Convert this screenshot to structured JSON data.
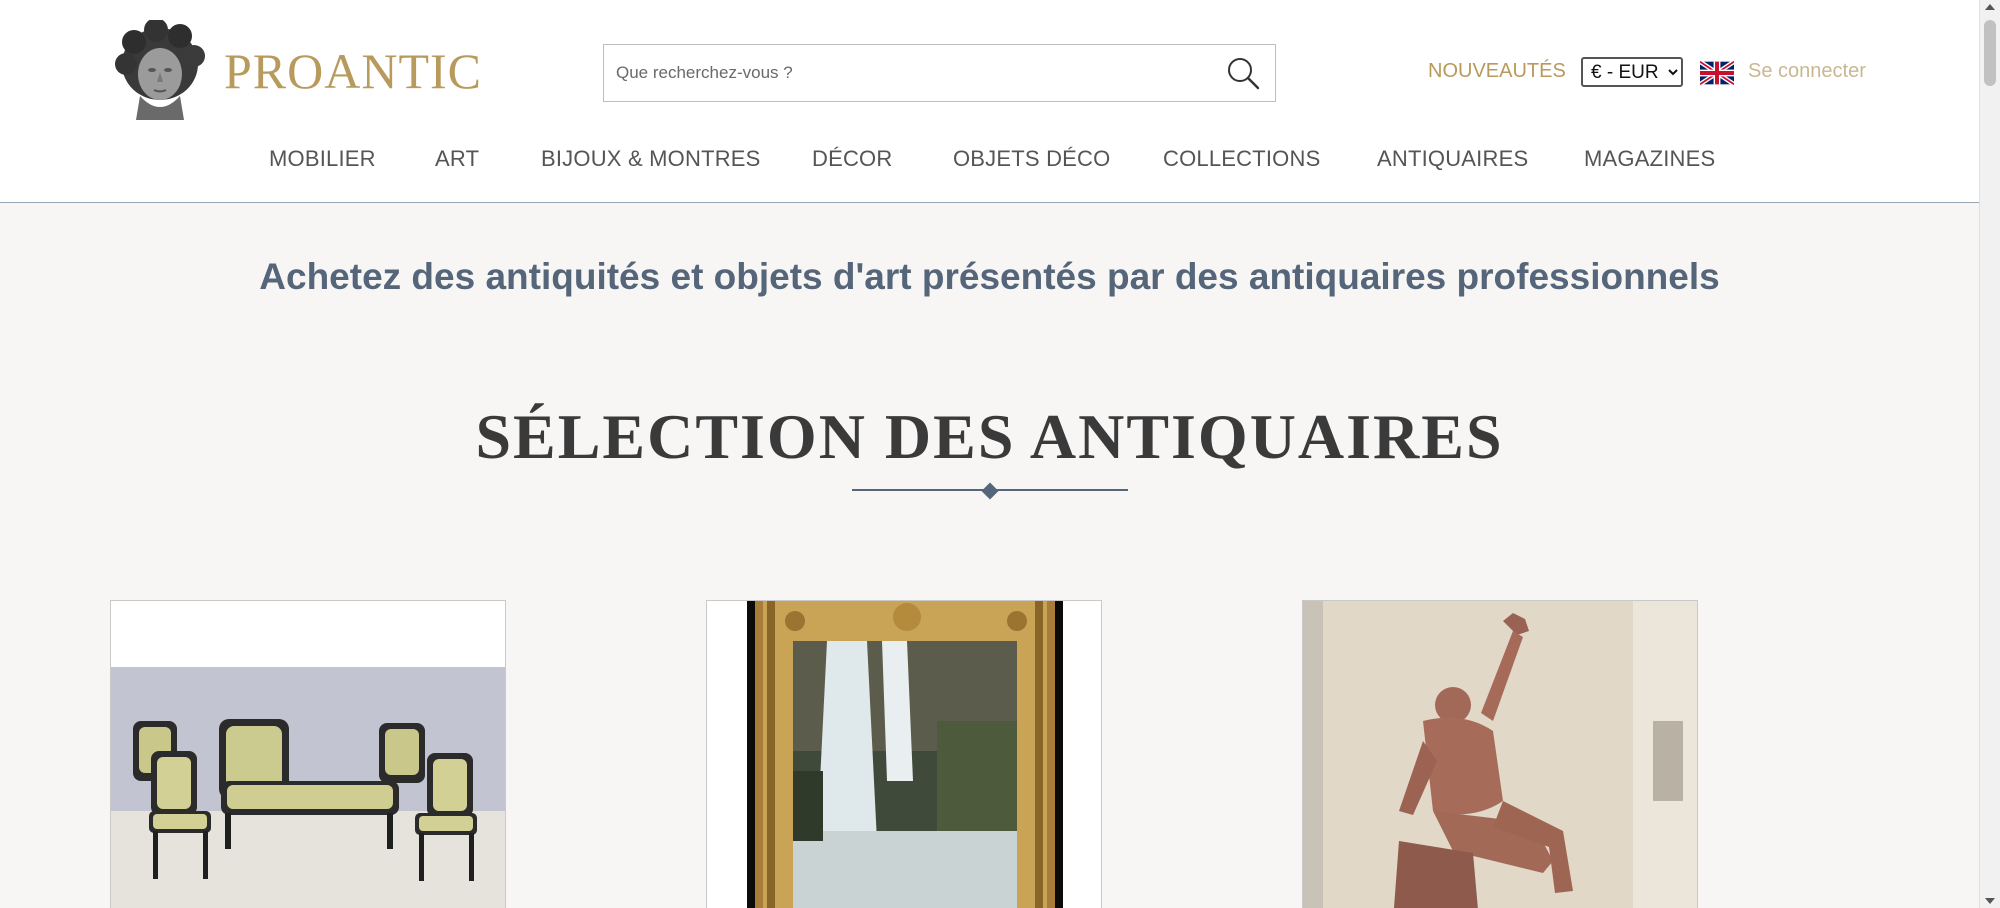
{
  "header": {
    "brand": "PROANTIC",
    "search_placeholder": "Que recherchez-vous ?",
    "nouveautes": "NOUVEAUTÉS",
    "currency": {
      "selected": "€ - EUR"
    },
    "language_flag": "uk-flag-icon",
    "login": "Se connecter"
  },
  "nav": {
    "items": [
      "MOBILIER",
      "ART",
      "BIJOUX & MONTRES",
      "DÉCOR",
      "OBJETS DÉCO",
      "COLLECTIONS",
      "ANTIQUAIRES",
      "MAGAZINES"
    ]
  },
  "main": {
    "tagline": "Achetez des antiquités et objets d'art présentés par des antiquaires professionnels",
    "section_title": "SÉLECTION DES ANTIQUAIRES",
    "cards": [
      {
        "image": "furniture-set-image"
      },
      {
        "image": "waterfall-painting-image"
      },
      {
        "image": "terracotta-sculpture-image"
      }
    ]
  },
  "colors": {
    "gold": "#b79a5c",
    "gold_light": "#c8b892",
    "slate": "#55657a",
    "background": "#f7f6f4"
  }
}
